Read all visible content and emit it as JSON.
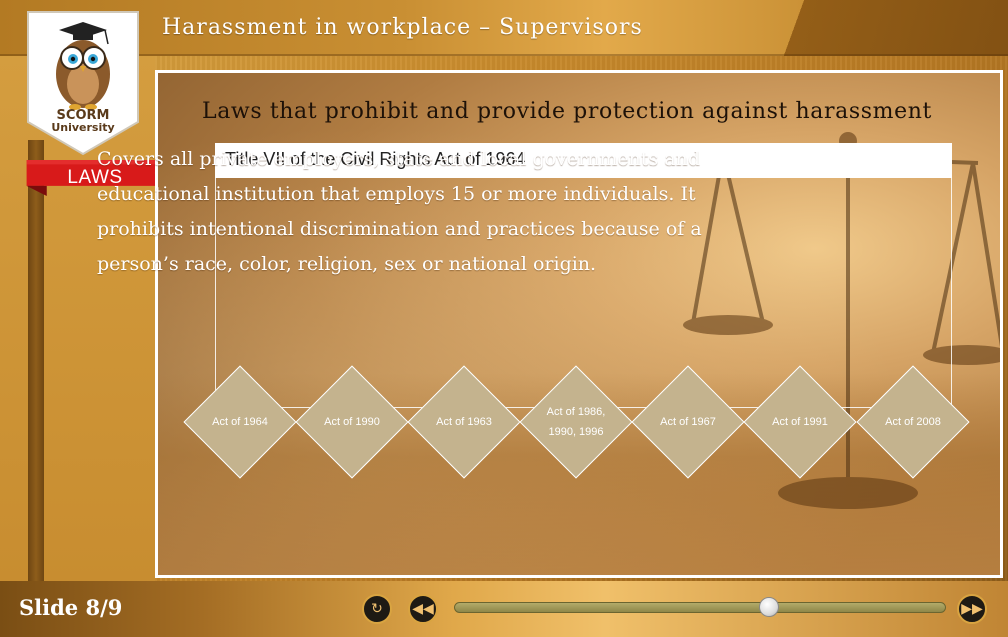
{
  "header": {
    "course_title": "Harassment in workplace – Supervisors"
  },
  "logo": {
    "line1": "SCORM",
    "line2": "University",
    "icon": "owl-graduate-icon"
  },
  "section": {
    "label": "LAWS"
  },
  "main": {
    "heading": "Laws that prohibit and provide protection against harassment",
    "selected_title": "Title VII of the Civil Rights Act of 1964",
    "description": "Covers all private employers, state and local governments and educational institution that employs 15 or more individuals. It prohibits intentional discrimination and practices because of a person’s race, color, religion, sex or national origin.",
    "acts": [
      {
        "label": "Act of 1964"
      },
      {
        "label": "Act of 1990"
      },
      {
        "label": "Act of 1963"
      },
      {
        "label": "Act of 1986,\n1990, 1996"
      },
      {
        "label": "Act of 1967"
      },
      {
        "label": "Act of 1991"
      },
      {
        "label": "Act of 2008"
      }
    ]
  },
  "footer": {
    "slide_label": "Slide 8/9",
    "progress": 0.64
  },
  "colors": {
    "diamond": "#c4b38e",
    "ribbon": "#d81a1a",
    "accent": "#d9a441"
  }
}
